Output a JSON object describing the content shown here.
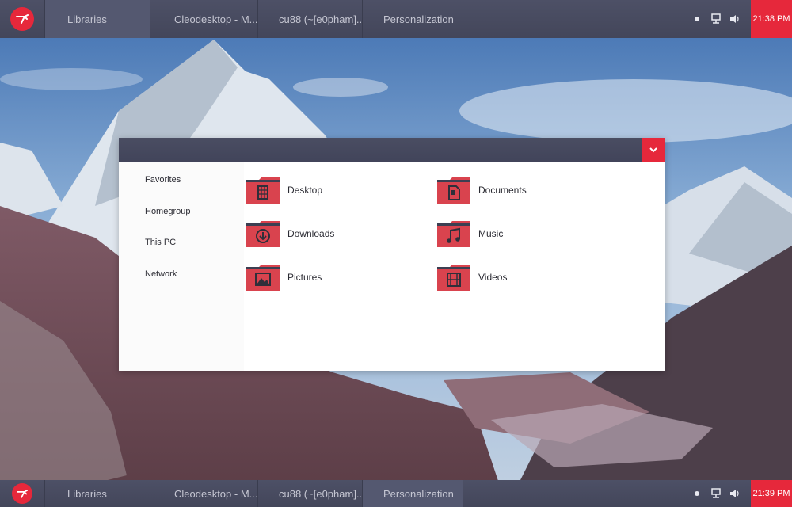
{
  "taskbar_top": {
    "tasks": [
      "Libraries",
      "Cleodesktop - M...",
      "cu88 (~[e0pham]...",
      "Personalization"
    ],
    "clock": "21:38 PM"
  },
  "taskbar_bottom": {
    "tasks": [
      "Libraries",
      "Cleodesktop - M...",
      "cu88 (~[e0pham]...",
      "Personalization"
    ],
    "clock": "21:39 PM"
  },
  "explorer": {
    "nav_items": [
      "Favorites",
      "Homegroup",
      "This PC",
      "Network"
    ],
    "folders": [
      {
        "label": "Desktop",
        "icon": "desktop-folder-icon"
      },
      {
        "label": "Documents",
        "icon": "documents-folder-icon"
      },
      {
        "label": "Downloads",
        "icon": "downloads-folder-icon"
      },
      {
        "label": "Music",
        "icon": "music-folder-icon"
      },
      {
        "label": "Pictures",
        "icon": "pictures-folder-icon"
      },
      {
        "label": "Videos",
        "icon": "videos-folder-icon"
      }
    ]
  },
  "colors": {
    "accent": "#e6283b",
    "taskbar": "#474a5e",
    "folder": "#d9434e"
  }
}
